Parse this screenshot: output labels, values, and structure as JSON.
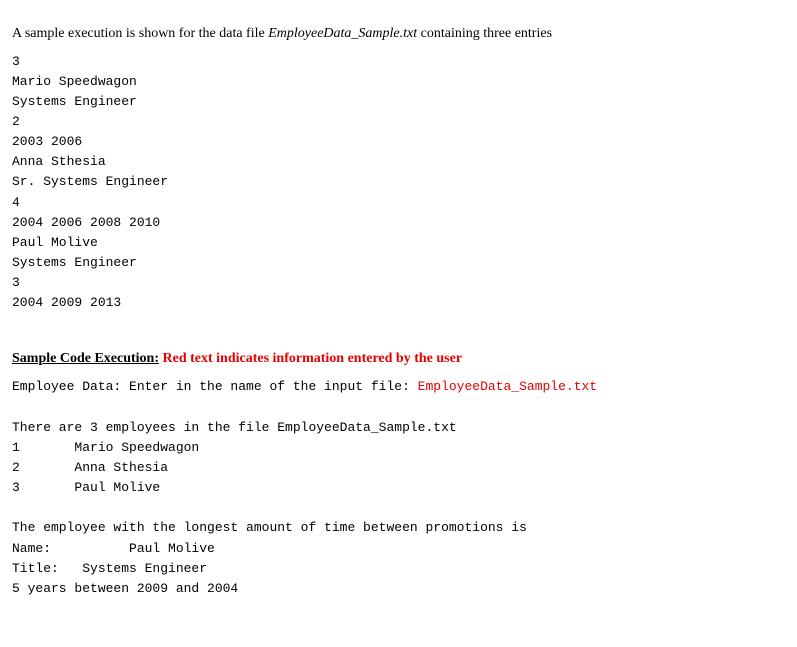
{
  "intro": {
    "prefix": "A sample execution is shown for the data file ",
    "filename": "EmployeeData_Sample.txt",
    "suffix": " containing three entries"
  },
  "datafile": "3\nMario Speedwagon\nSystems Engineer\n2\n2003 2006\nAnna Sthesia\nSr. Systems Engineer\n4\n2004 2006 2008 2010\nPaul Molive\nSystems Engineer\n3\n2004 2009 2013",
  "heading": {
    "label": "Sample Code Execution:",
    "red": "Red text indicates information entered by the user"
  },
  "execution": {
    "prompt": "Employee Data: Enter in the name of the input file: ",
    "input_filename": "EmployeeData_Sample.txt",
    "summary_line": "There are 3 employees in the file EmployeeData_Sample.txt",
    "employee_list": "1       Mario Speedwagon\n2       Anna Sthesia\n3       Paul Molive",
    "longest_intro": "The employee with the longest amount of time between promotions is",
    "name_line": "Name:          Paul Molive",
    "title_line": "Title:   Systems Engineer",
    "years_line": "5 years between 2009 and 2004"
  }
}
